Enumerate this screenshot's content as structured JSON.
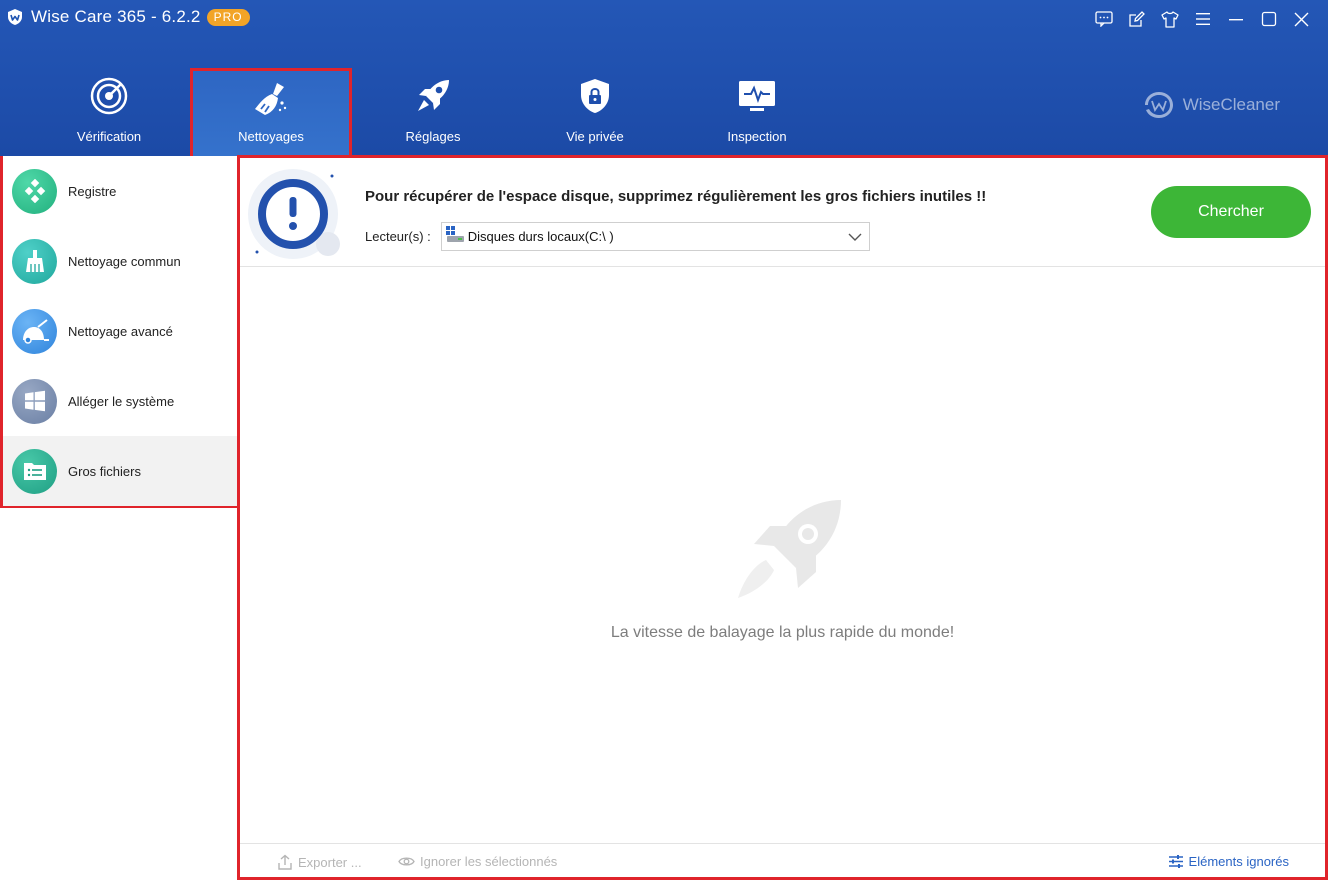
{
  "app": {
    "title": "Wise Care 365 - 6.2.2",
    "badge": "PRO",
    "brand": "WiseCleaner"
  },
  "nav": {
    "tabs": [
      {
        "label": "Vérification",
        "icon": "radar-icon"
      },
      {
        "label": "Nettoyages",
        "icon": "broom-icon",
        "active": true
      },
      {
        "label": "Réglages",
        "icon": "rocket-icon"
      },
      {
        "label": "Vie privée",
        "icon": "shield-lock-icon"
      },
      {
        "label": "Inspection",
        "icon": "monitor-pulse-icon"
      }
    ]
  },
  "sidebar": {
    "items": [
      {
        "label": "Registre",
        "icon": "registry-icon",
        "color": "#2fbf8f"
      },
      {
        "label": "Nettoyage commun",
        "icon": "broom-icon",
        "color": "#28b5a8"
      },
      {
        "label": "Nettoyage avancé",
        "icon": "vacuum-icon",
        "color": "#3c8fe0"
      },
      {
        "label": "Alléger le système",
        "icon": "windows-icon",
        "color": "#7a8fb0"
      },
      {
        "label": "Gros fichiers",
        "icon": "file-list-icon",
        "color": "#2aa890",
        "active": true
      }
    ]
  },
  "main": {
    "info_text": "Pour récupérer de l'espace disque, supprimez régulièrement les gros fichiers inutiles !!",
    "drive_label": "Lecteur(s) :",
    "drive_value": "Disques durs locaux(C:\\ )",
    "search_button": "Chercher",
    "empty_text": "La vitesse de balayage la plus rapide du monde!",
    "bottom": {
      "export": "Exporter ...",
      "ignore_selected": "Ignorer les sélectionnés",
      "ignored_items": "Eléments ignorés"
    }
  },
  "colors": {
    "header": "#2055b2",
    "highlight_border": "#e0242b",
    "search_button": "#3db637",
    "pro_badge": "#f2a427",
    "link": "#2a64c4"
  }
}
